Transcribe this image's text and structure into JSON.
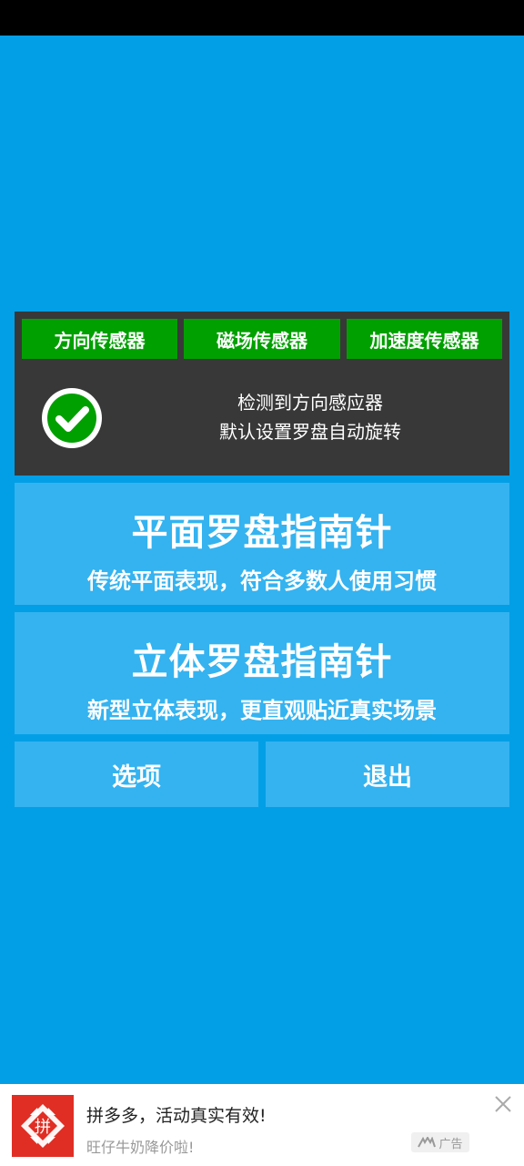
{
  "sensors": {
    "buttons": [
      "方向传感器",
      "磁场传感器",
      "加速度传感器"
    ],
    "message_line1": "检测到方向感应器",
    "message_line2": "默认设置罗盘自动旋转"
  },
  "modes": [
    {
      "title": "平面罗盘指南针",
      "subtitle": "传统平面表现，符合多数人使用习惯"
    },
    {
      "title": "立体罗盘指南针",
      "subtitle": "新型立体表现，更直观贴近真实场景"
    }
  ],
  "actions": {
    "options_label": "选项",
    "exit_label": "退出"
  },
  "ad": {
    "title": "拼多多，活动真实有效!",
    "subtitle": "旺仔牛奶降价啦!",
    "tag": "广告",
    "logo_text": "拼"
  },
  "colors": {
    "background": "#039fe6",
    "sensor_button": "#00a000",
    "panel": "#383838",
    "card": "#34b3f0",
    "ad_logo": "#e02e24"
  },
  "icons": {
    "status": "check-circle-icon",
    "close": "close-icon",
    "ad_brand": "pinduoduo-logo"
  }
}
